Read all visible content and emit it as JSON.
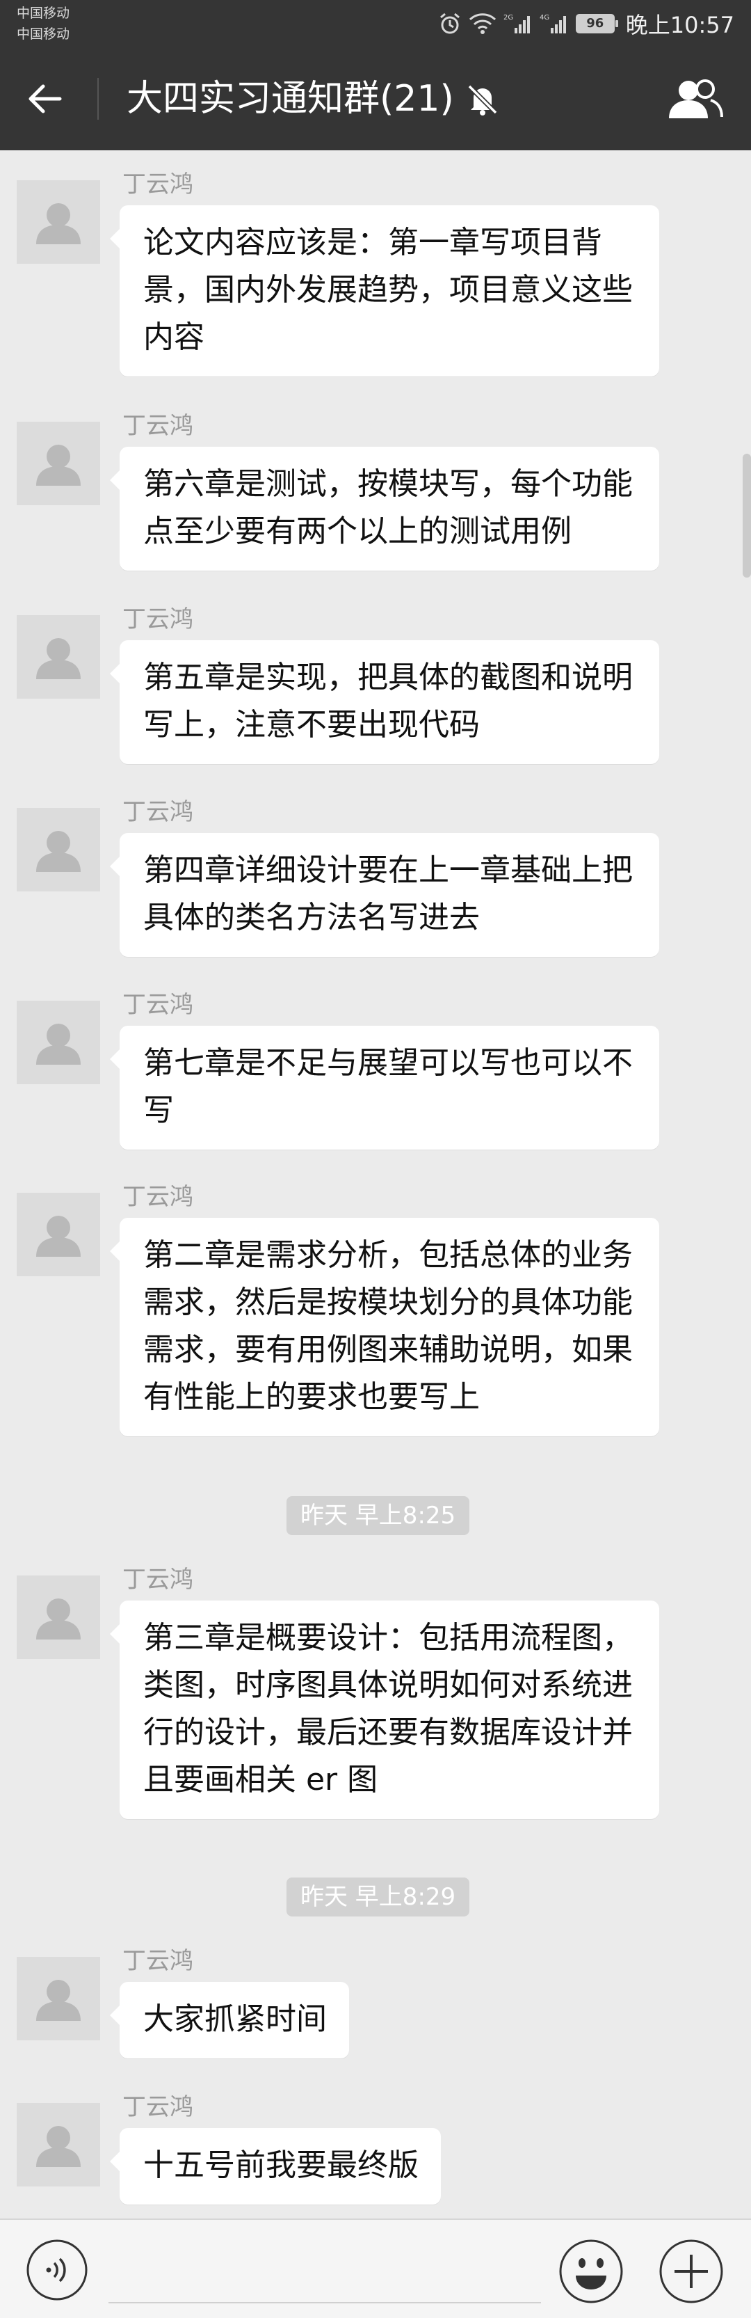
{
  "status_bar": {
    "carrier_1": "中国移动",
    "carrier_2": "中国移动",
    "battery": "96",
    "time": "晚上10:57",
    "icons": [
      "alarm-icon",
      "wifi-icon",
      "signal-2g-icon",
      "signal-4g-icon",
      "battery-icon"
    ]
  },
  "header": {
    "title": "大四实习通知群(21)",
    "back_icon": "arrow-left-icon",
    "mute_icon": "bell-muted-icon",
    "members_icon": "group-members-icon"
  },
  "messages": [
    {
      "sender": "丁云鸿",
      "text": "论文内容应该是：第一章写项目背景，国内外发展趋势，项目意义这些内容"
    },
    {
      "sender": "丁云鸿",
      "text": "第六章是测试，按模块写，每个功能点至少要有两个以上的测试用例"
    },
    {
      "sender": "丁云鸿",
      "text": "第五章是实现，把具体的截图和说明写上，注意不要出现代码"
    },
    {
      "sender": "丁云鸿",
      "text": "第四章详细设计要在上一章基础上把具体的类名方法名写进去"
    },
    {
      "sender": "丁云鸿",
      "text": "第七章是不足与展望可以写也可以不写"
    },
    {
      "sender": "丁云鸿",
      "text": "第二章是需求分析，包括总体的业务需求，然后是按模块划分的具体功能需求，要有用例图来辅助说明，如果有性能上的要求也要写上"
    },
    {
      "sender": "丁云鸿",
      "text": "第三章是概要设计：包括用流程图，类图，时序图具体说明如何对系统进行的设计，最后还要有数据库设计并且要画相关 er 图"
    },
    {
      "sender": "丁云鸿",
      "text": "大家抓紧时间"
    },
    {
      "sender": "丁云鸿",
      "text": "十五号前我要最终版"
    }
  ],
  "timestamps": [
    "昨天 早上8:25",
    "昨天 早上8:29"
  ],
  "input_bar": {
    "voice_icon": "voice-input-icon",
    "emoji_icon": "emoji-icon",
    "more_icon": "plus-icon"
  },
  "colors": {
    "bar_bg": "#353535",
    "chat_bg": "#ebebeb",
    "bubble_bg": "#ffffff",
    "timestamp_bg": "#d2d2d2",
    "sender_text": "#9a9a9a"
  }
}
